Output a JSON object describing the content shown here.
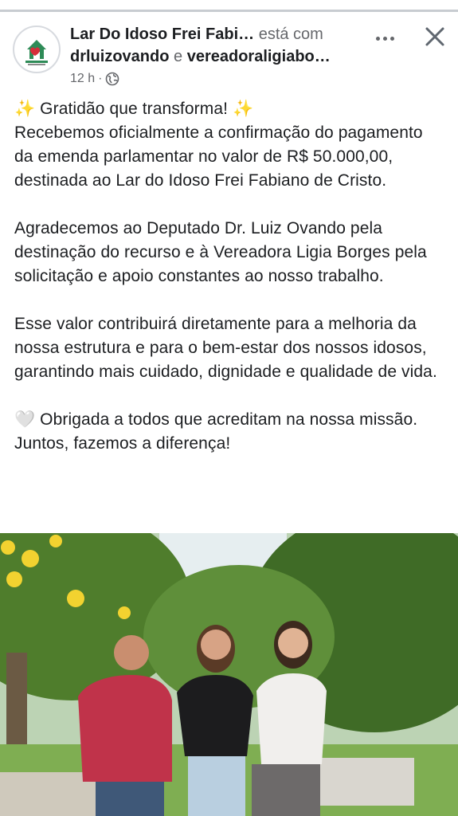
{
  "header": {
    "author": "Lar Do Idoso Frei Fabi…",
    "with_text": " está com",
    "tag1": "drluizovando",
    "tag_joiner": " e ",
    "tag2": "vereadoraligiabo…",
    "time": "12 h",
    "separator": "·"
  },
  "post": {
    "p1_sparkle_left": "✨",
    "p1_title": " Gratidão que transforma! ",
    "p1_sparkle_right": "✨",
    "p1_body": "Recebemos oficialmente a confirmação do pagamento da emenda parlamentar no valor de R$ 50.000,00, destinada ao  Lar do Idoso Frei Fabiano de Cristo.",
    "p2": "Agradecemos ao Deputado Dr. Luiz Ovando pela destinação do recurso e à Vereadora Ligia Borges pela solicitação e apoio constantes ao nosso trabalho.",
    "p3": "Esse valor contribuirá diretamente para a melhoria da nossa estrutura e para o bem-estar dos nossos idosos, garantindo mais cuidado, dignidade e qualidade de vida.",
    "p4_heart": "🤍",
    "p4": " Obrigada a todos que acreditam na nossa missão. Juntos, fazemos a diferença!"
  },
  "icons": {
    "globe": "globe-icon",
    "more": "more-options-icon",
    "close": "close-icon",
    "avatar": "organization-logo"
  },
  "colors": {
    "muted": "#65676b",
    "text": "#1c1e21",
    "sparkle": "#f5c518"
  }
}
